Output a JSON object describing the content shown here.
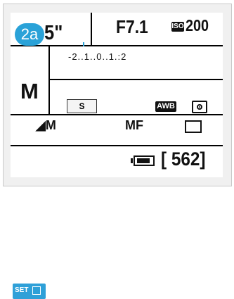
{
  "badge": {
    "label": "2a"
  },
  "exposure": {
    "shutter_speed": "5\"",
    "aperture": "F7.1",
    "iso_label": "ISO",
    "iso_value": "200",
    "compensation_scale": "-2..1..0..1.:2"
  },
  "mode": {
    "label": "M"
  },
  "settings": {
    "picture_style": "S",
    "white_balance": "AWB",
    "metering": "evaluative-metering-icon"
  },
  "capture": {
    "image_quality": "M",
    "focus_mode": "MF",
    "drive_mode": "single-shot-icon",
    "battery": "battery-icon",
    "shots_remaining": "[ 562]"
  },
  "buttons": {
    "set": "SET"
  },
  "colors": {
    "accent": "#2aa2d8",
    "background": "#ffffff",
    "grid": "#000000",
    "text": "#111111"
  }
}
